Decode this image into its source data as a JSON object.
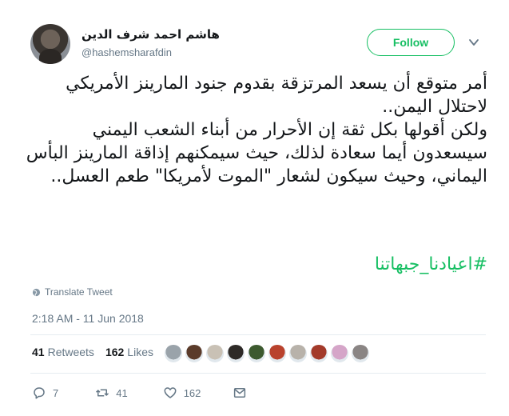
{
  "author": {
    "name": "هاشم احمد شرف الدين",
    "handle": "@hashemsharafdin"
  },
  "follow_label": "Follow",
  "tweet": {
    "text": "أمر متوقع أن يسعد المرتزقة بقدوم جنود المارينز الأمريكي لاحتلال اليمن..\nولكن أقولها بكل ثقة إن الأحرار من أبناء الشعب اليمني سيسعدون أيما سعادة لذلك، حيث سيمكنهم إذاقة المارينز البأس اليماني، وحيث سيكون لشعار \"الموت لأمريكا\" طعم العسل..",
    "hashtag": "#اعيادنا_جبهاتنا"
  },
  "translate_label": "Translate Tweet",
  "timestamp": "2:18 AM - 11 Jun 2018",
  "stats": {
    "retweets_count": "41",
    "retweets_label": "Retweets",
    "likes_count": "162",
    "likes_label": "Likes"
  },
  "actions": {
    "reply_count": "7",
    "retweet_count": "41",
    "like_count": "162"
  },
  "colors": {
    "accent": "#17bf63",
    "muted": "#657786"
  },
  "likers": [
    {
      "color": "#9aa3aa"
    },
    {
      "color": "#5b3b2a"
    },
    {
      "color": "#c9c1b5"
    },
    {
      "color": "#2e2a27"
    },
    {
      "color": "#3d5a2f"
    },
    {
      "color": "#b9422d"
    },
    {
      "color": "#b8b2aa"
    },
    {
      "color": "#a33a2a"
    },
    {
      "color": "#d5a5c8"
    },
    {
      "color": "#8a8584"
    }
  ]
}
